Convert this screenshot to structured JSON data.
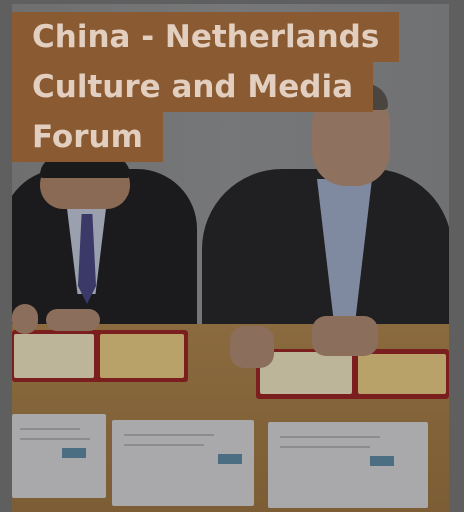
{
  "banner": {
    "line1": "China - Netherlands",
    "line2": "Culture and Media",
    "line3": "Forum",
    "background_color": "#8a5a32",
    "text_color": "#e3cfc0"
  },
  "photo": {
    "depicts": "two-men-signing-documents-at-table"
  }
}
